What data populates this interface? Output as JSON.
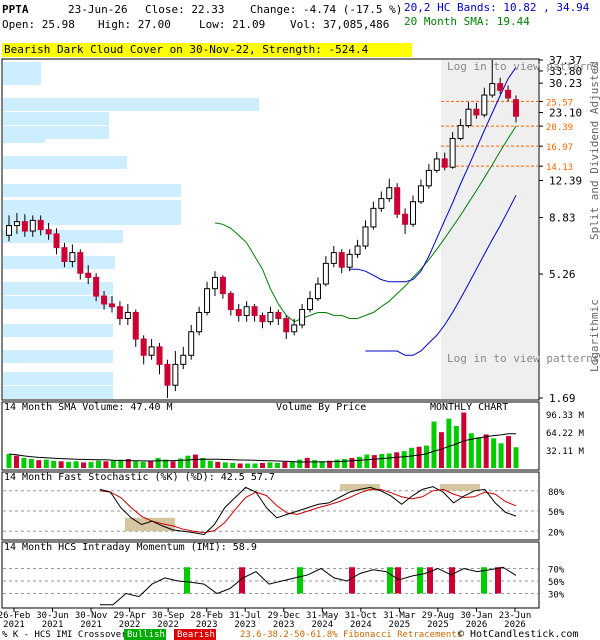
{
  "header": {
    "ticker": "PPTA",
    "date": "23-Jun-26",
    "close": "Close: 22.33",
    "change": "Change: -4.74 (-17.5 %)",
    "open": "Open: 25.98",
    "high": "High: 27.00",
    "low": "Low: 21.09",
    "vol": "Vol: 37,085,486",
    "hc_bands": "20,2 HC Bands: 10.82 , 34.94",
    "sma20": "20 Month SMA: 19.44"
  },
  "banner": "Bearish Dark Cloud Cover on 30-Nov-22, Strength: -524.4",
  "colors": {
    "up": "#00cc00",
    "down": "#cc0033",
    "sma": "#008000",
    "band": "#0000cc",
    "vbp": "#cceeff",
    "fib": "#ff6600",
    "stoch_k": "#000000",
    "stoch_d": "#cc0000",
    "shade": "#c8b88a"
  },
  "main": {
    "y_ticks": [
      "37.37",
      "33.80",
      "30.23",
      "25.57",
      "23.10",
      "20.39",
      "16.97",
      "14.13",
      "12.39",
      "8.83",
      "5.26",
      "1.69"
    ],
    "right_label_top": "Split and Dividend Adjusted",
    "right_label_bottom": "Logarithmic",
    "login_top": "Log in to view patterns in this area",
    "login_bottom": "Log in to view patterns in this area"
  },
  "volume_panel": {
    "title": "14 Month SMA Volume: 47.40 M",
    "vbp_label": "Volume By Price",
    "chart_label": "MONTHLY CHART",
    "y_ticks": [
      "96.33 M",
      "64.22 M",
      "32.11 M"
    ]
  },
  "stoch_panel": {
    "title": "14 Month Fast Stochastic (%K) (%D): 42.5  57.7",
    "y_ticks": [
      "80%",
      "50%",
      "20%"
    ]
  },
  "imi_panel": {
    "title": "14 Month HCS Intraday Momentum (IMI): 58.9",
    "y_ticks": [
      "70%",
      "50%",
      "30%"
    ]
  },
  "x_axis": {
    "labels": [
      "26-Feb 2021",
      "30-Jun 2021",
      "30-Nov 2021",
      "29-Apr 2022",
      "30-Sep 2022",
      "28-Feb 2023",
      "31-Jul 2023",
      "29-Dec 2023",
      "31-May 2024",
      "31-Oct 2024",
      "31-Mar 2025",
      "29-Aug 2025",
      "30-Jan 2026",
      "23-Jun 2026"
    ]
  },
  "footer": {
    "legend_prefix": "% K - HCS IMI Crossover:",
    "bullish": "Bullish",
    "bearish": "Bearish",
    "fib": "23.6-38.2-50-61.8% Fibonacci Retracements",
    "copyright": "© HotCandlestick.com"
  },
  "chart_data": {
    "type": "candlestick",
    "interval": "monthly",
    "scale": "log",
    "ylim": [
      1.69,
      37.37
    ],
    "x": [
      "2021-02",
      "2021-03",
      "2021-04",
      "2021-05",
      "2021-06",
      "2021-07",
      "2021-08",
      "2021-09",
      "2021-10",
      "2021-11",
      "2021-12",
      "2022-01",
      "2022-02",
      "2022-03",
      "2022-04",
      "2022-05",
      "2022-06",
      "2022-07",
      "2022-08",
      "2022-09",
      "2022-10",
      "2022-11",
      "2022-12",
      "2023-01",
      "2023-02",
      "2023-03",
      "2023-04",
      "2023-05",
      "2023-06",
      "2023-07",
      "2023-08",
      "2023-09",
      "2023-10",
      "2023-11",
      "2023-12",
      "2024-01",
      "2024-02",
      "2024-03",
      "2024-04",
      "2024-05",
      "2024-06",
      "2024-07",
      "2024-08",
      "2024-09",
      "2024-10",
      "2024-11",
      "2024-12",
      "2025-01",
      "2025-02",
      "2025-03",
      "2025-04",
      "2025-05",
      "2025-06",
      "2025-07",
      "2025-08",
      "2025-09",
      "2025-10",
      "2025-11",
      "2025-12",
      "2026-01",
      "2026-02",
      "2026-03",
      "2026-04",
      "2026-05",
      "2026-06"
    ],
    "close": [
      8.2,
      8.5,
      7.8,
      8.6,
      7.9,
      7.6,
      6.7,
      5.9,
      6.4,
      5.3,
      5.1,
      4.3,
      4.0,
      3.9,
      3.5,
      3.7,
      2.9,
      2.5,
      2.7,
      2.3,
      1.9,
      2.3,
      2.5,
      3.1,
      3.7,
      4.6,
      5.1,
      4.4,
      3.8,
      3.6,
      3.9,
      3.6,
      3.4,
      3.7,
      3.5,
      3.1,
      3.3,
      3.8,
      4.2,
      4.8,
      5.8,
      6.4,
      5.6,
      6.3,
      6.8,
      8.1,
      9.6,
      10.5,
      11.6,
      9.1,
      8.3,
      10.2,
      11.8,
      13.6,
      15.1,
      14.0,
      18.2,
      20.5,
      23.8,
      22.6,
      27.1,
      30.1,
      28.3,
      26.4,
      22.33
    ],
    "open": [
      7.5,
      8.2,
      8.5,
      7.8,
      8.6,
      7.9,
      7.6,
      6.7,
      5.9,
      6.4,
      5.3,
      5.1,
      4.3,
      4.0,
      3.9,
      3.5,
      3.7,
      2.9,
      2.5,
      2.7,
      2.3,
      1.9,
      2.3,
      2.5,
      3.1,
      3.7,
      4.6,
      5.1,
      4.4,
      3.8,
      3.6,
      3.9,
      3.6,
      3.4,
      3.7,
      3.5,
      3.1,
      3.3,
      3.8,
      4.2,
      4.8,
      5.8,
      6.4,
      5.6,
      6.3,
      6.8,
      8.1,
      9.6,
      10.5,
      11.6,
      9.1,
      8.3,
      10.2,
      11.8,
      13.6,
      15.1,
      14.0,
      18.2,
      20.5,
      23.8,
      22.6,
      27.1,
      30.1,
      28.3,
      25.98
    ],
    "high": [
      9.0,
      9.2,
      9.1,
      9.0,
      9.0,
      8.4,
      8.0,
      7.0,
      6.9,
      6.6,
      5.7,
      5.3,
      4.5,
      4.3,
      4.1,
      4.0,
      3.8,
      3.0,
      2.9,
      2.8,
      2.4,
      2.6,
      2.7,
      3.3,
      3.9,
      4.9,
      5.4,
      5.2,
      4.5,
      4.0,
      4.1,
      4.0,
      3.7,
      3.9,
      3.8,
      3.6,
      3.5,
      4.0,
      4.5,
      5.1,
      6.2,
      6.8,
      6.6,
      6.6,
      7.2,
      8.6,
      10.2,
      11.2,
      12.6,
      12.1,
      9.6,
      10.8,
      12.5,
      14.4,
      16.1,
      16.0,
      19.3,
      21.8,
      25.4,
      25.2,
      29.0,
      37.37,
      31.8,
      29.6,
      27.0
    ],
    "low": [
      7.1,
      7.6,
      7.4,
      7.4,
      7.5,
      7.2,
      6.3,
      5.6,
      5.6,
      5.0,
      4.8,
      4.1,
      3.8,
      3.7,
      3.3,
      3.3,
      2.7,
      2.3,
      2.4,
      2.1,
      1.69,
      1.8,
      2.2,
      2.4,
      3.0,
      3.6,
      4.3,
      4.2,
      3.6,
      3.4,
      3.4,
      3.4,
      3.2,
      3.3,
      3.3,
      2.9,
      3.0,
      3.2,
      3.7,
      4.1,
      4.7,
      5.6,
      5.3,
      5.4,
      6.1,
      6.6,
      7.9,
      9.3,
      10.2,
      8.8,
      7.6,
      8.1,
      10.0,
      11.5,
      13.3,
      13.6,
      13.8,
      17.9,
      20.1,
      21.8,
      22.1,
      26.5,
      27.4,
      25.6,
      21.09
    ],
    "volume_m": [
      25,
      22,
      18,
      16,
      14,
      15,
      13,
      12,
      11,
      12,
      10,
      11,
      13,
      12,
      14,
      15,
      16,
      12,
      11,
      13,
      18,
      15,
      12,
      17,
      22,
      24,
      18,
      13,
      11,
      10,
      9,
      8,
      8,
      8,
      9,
      10,
      9,
      11,
      12,
      15,
      18,
      14,
      12,
      13,
      15,
      16,
      18,
      20,
      24,
      23,
      25,
      26,
      28,
      30,
      36,
      38,
      40,
      83,
      64,
      88,
      75,
      99,
      62,
      55,
      60,
      53,
      44,
      57,
      37
    ],
    "sma20": [
      8.4,
      8.3,
      8.0,
      7.5,
      7.0,
      6.2,
      5.5,
      4.6,
      4.0,
      3.6,
      3.4,
      3.5,
      3.6,
      3.7,
      3.7,
      3.6,
      3.6,
      3.5,
      3.5,
      3.6,
      3.7,
      3.9,
      4.1,
      4.4,
      4.7,
      5.1,
      5.5,
      6.0,
      6.6,
      7.3,
      8.1,
      9.0,
      10.1,
      11.3,
      12.7,
      14.3,
      16.2,
      18.2,
      20.39
    ],
    "upper_band": [
      5.5,
      5.5,
      5.4,
      5.2,
      5.0,
      4.9,
      4.9,
      4.9,
      5.0,
      5.4,
      6.2,
      7.3,
      8.6,
      10.1,
      12.0,
      14.1,
      16.6,
      19.6,
      23.0,
      27.0,
      31.5,
      34.94
    ],
    "lower_band": [
      2.6,
      2.6,
      2.6,
      2.6,
      2.6,
      2.5,
      2.5,
      2.6,
      2.8,
      3.0,
      3.3,
      3.7,
      4.2,
      4.8,
      5.5,
      6.3,
      7.2,
      8.2,
      9.4,
      10.82
    ],
    "fib_levels": [
      25.57,
      20.39,
      16.97,
      14.13
    ],
    "stoch_k": [
      82,
      78,
      55,
      40,
      30,
      35,
      28,
      22,
      20,
      18,
      15,
      30,
      55,
      70,
      85,
      78,
      55,
      40,
      45,
      50,
      55,
      60,
      62,
      70,
      78,
      82,
      85,
      80,
      72,
      60,
      72,
      82,
      86,
      78,
      62,
      72,
      80,
      82,
      62,
      48,
      42.5
    ],
    "stoch_d": [
      80,
      78,
      70,
      55,
      42,
      35,
      31,
      28,
      23,
      20,
      18,
      21,
      33,
      52,
      70,
      78,
      73,
      58,
      47,
      45,
      50,
      55,
      59,
      64,
      70,
      77,
      82,
      82,
      77,
      71,
      68,
      71,
      80,
      82,
      75,
      70,
      71,
      78,
      75,
      64,
      57.7
    ],
    "imi": [
      0,
      0,
      30,
      25,
      45,
      55,
      50,
      48,
      45,
      30,
      38,
      55,
      65,
      45,
      50,
      55,
      60,
      70,
      55,
      50,
      62,
      68,
      65,
      52,
      58,
      62,
      70,
      60,
      70,
      65,
      68,
      72,
      58.9
    ]
  }
}
